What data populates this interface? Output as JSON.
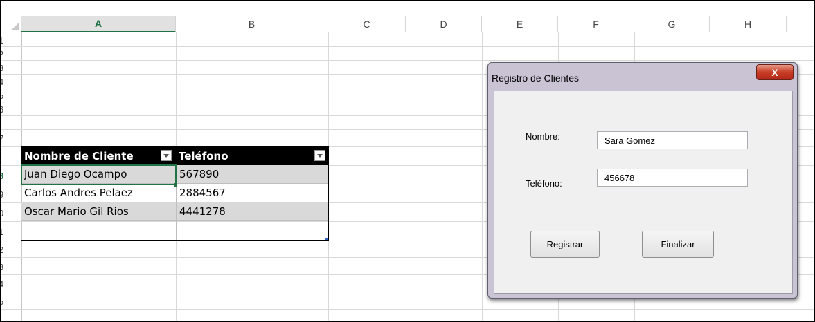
{
  "sheet": {
    "columns": [
      "A",
      "B",
      "C",
      "D",
      "E",
      "F",
      "G",
      "H"
    ],
    "selected_column": "A",
    "rows": [
      "1",
      "2",
      "3",
      "4",
      "5",
      "6",
      "7",
      "8",
      "9",
      "0",
      "1",
      "2",
      "3",
      "4",
      "5"
    ],
    "selected_row_index": 7
  },
  "table": {
    "headers": [
      "Nombre de Cliente",
      "Teléfono"
    ],
    "rows": [
      [
        "Juan Diego Ocampo",
        "567890"
      ],
      [
        "Carlos Andres Pelaez",
        "2884567"
      ],
      [
        "Oscar Mario Gil Rios",
        "4441278"
      ],
      [
        "",
        ""
      ]
    ]
  },
  "dialog": {
    "title": "Registro de Clientes",
    "close_label": "X",
    "nombre_label": "Nombre:",
    "nombre_value": "Sara Gomez",
    "telefono_label": "Teléfono:",
    "telefono_value": "456678",
    "registrar_label": "Registrar",
    "finalizar_label": "Finalizar"
  },
  "colors": {
    "excel_green": "#217346",
    "table_header_bg": "#000000",
    "band_row": "#d9d9d9",
    "close_button": "#c73d25"
  }
}
